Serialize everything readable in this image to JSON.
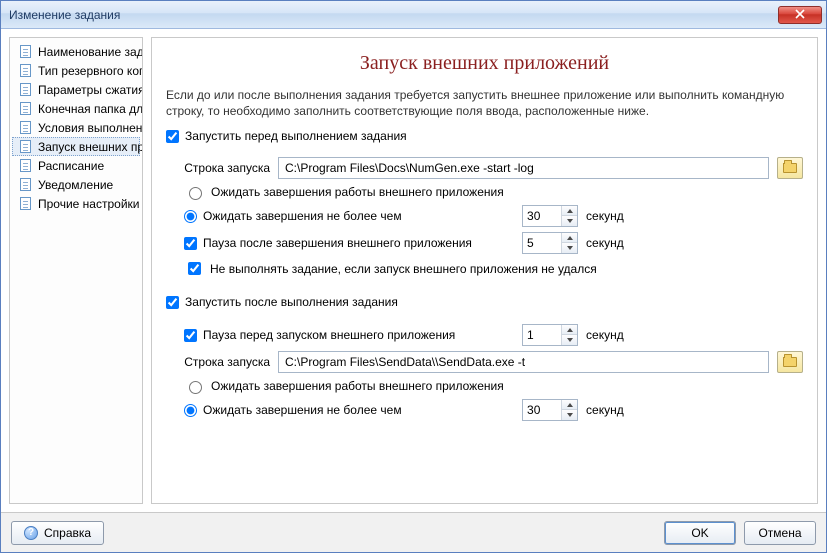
{
  "window": {
    "title": "Изменение задания"
  },
  "sidebar": {
    "items": [
      {
        "label": "Наименование задания"
      },
      {
        "label": "Тип резервного копирования"
      },
      {
        "label": "Параметры сжатия ZIP"
      },
      {
        "label": "Конечная папка для синхронизации"
      },
      {
        "label": "Условия выполнения"
      },
      {
        "label": "Запуск внешних приложений"
      },
      {
        "label": "Расписание"
      },
      {
        "label": "Уведомление"
      },
      {
        "label": "Прочие настройки"
      }
    ],
    "selected_index": 5
  },
  "page": {
    "title": "Запуск внешних приложений",
    "intro": "Если до или после выполнения задания требуется запустить внешнее приложение или выполнить командную строку, то необходимо заполнить соответствующие поля ввода, расположенные ниже."
  },
  "before": {
    "enable_label": "Запустить перед выполнением задания",
    "enable_checked": true,
    "cmd_label": "Строка запуска",
    "cmd_value": "C:\\Program Files\\Docs\\NumGen.exe -start -log",
    "wait_finish_label": "Ожидать завершения работы внешнего приложения",
    "wait_timeout_label": "Ожидать завершения не более чем",
    "wait_mode": "timeout",
    "timeout_value": 30,
    "seconds_label": "секунд",
    "pause_after_label": "Пауза после завершения внешнего приложения",
    "pause_after_checked": true,
    "pause_after_value": 5,
    "abort_label": "Не выполнять задание, если запуск внешнего приложения не удался",
    "abort_checked": true
  },
  "after": {
    "enable_label": "Запустить после выполнения задания",
    "enable_checked": true,
    "pause_before_label": "Пауза перед запуском внешнего приложения",
    "pause_before_checked": true,
    "pause_before_value": 1,
    "cmd_label": "Строка запуска",
    "cmd_value": "C:\\Program Files\\SendData\\\\SendData.exe -t",
    "wait_finish_label": "Ожидать завершения работы внешнего приложения",
    "wait_timeout_label": "Ожидать завершения не более чем",
    "wait_mode": "timeout",
    "timeout_value": 30,
    "seconds_label": "секунд"
  },
  "footer": {
    "help_label": "Справка",
    "ok_label": "OK",
    "cancel_label": "Отмена"
  }
}
